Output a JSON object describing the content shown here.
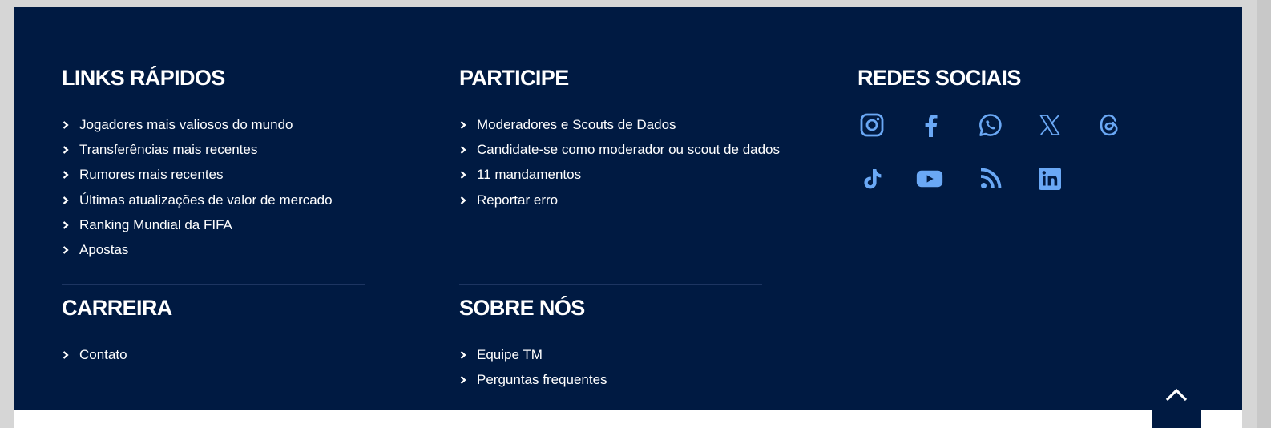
{
  "quick_links": {
    "title": "LINKS RÁPIDOS",
    "items": [
      "Jogadores mais valiosos do mundo",
      "Transferências mais recentes",
      "Rumores mais recentes",
      "Últimas atualizações de valor de mercado",
      "Ranking Mundial da FIFA",
      "Apostas"
    ]
  },
  "participate": {
    "title": "PARTICIPE",
    "items": [
      "Moderadores e Scouts de Dados",
      "Candidate-se como moderador ou scout de dados",
      "11 mandamentos",
      "Reportar erro"
    ]
  },
  "career": {
    "title": "CARREIRA",
    "items": [
      "Contato"
    ]
  },
  "about": {
    "title": "SOBRE NÓS",
    "items": [
      "Equipe TM",
      "Perguntas frequentes"
    ]
  },
  "social": {
    "title": "REDES SOCIAIS",
    "icons": [
      "instagram-icon",
      "facebook-icon",
      "whatsapp-icon",
      "x-icon",
      "threads-icon",
      "tiktok-icon",
      "youtube-icon",
      "rss-icon",
      "linkedin-icon"
    ]
  },
  "colors": {
    "footer_bg": "#001a42",
    "icon": "#6aa8f5",
    "text": "#ffffff"
  }
}
